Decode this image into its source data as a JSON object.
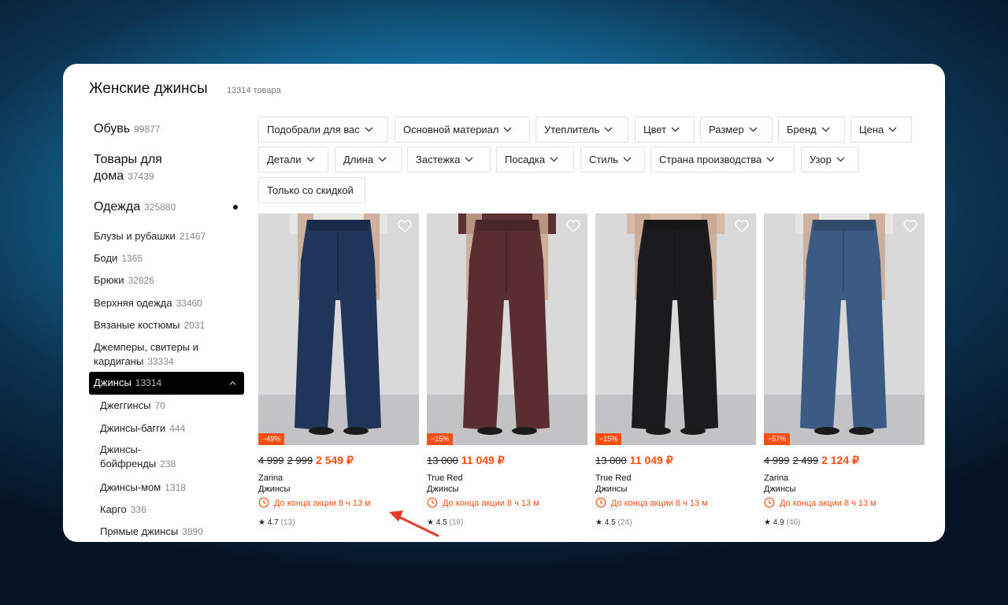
{
  "header": {
    "title": "Женские джинсы",
    "count": "13314 товара"
  },
  "sidebar": {
    "top": [
      {
        "label": "Обувь",
        "count": "99877"
      },
      {
        "label": "Товары для",
        "label2": "дома",
        "count": "37439"
      },
      {
        "label": "Одежда",
        "count": "325880"
      }
    ],
    "subs": [
      {
        "label": "Блузы и рубашки",
        "count": "21467"
      },
      {
        "label": "Боди",
        "count": "1365"
      },
      {
        "label": "Брюки",
        "count": "32826"
      },
      {
        "label": "Верхняя одежда",
        "count": "33460"
      },
      {
        "label": "Вязаные костюмы",
        "count": "2031"
      },
      {
        "label": "Джемперы, свитеры и",
        "label2": "кардиганы",
        "count": "33334"
      }
    ],
    "active": {
      "label": "Джинсы",
      "count": "13314"
    },
    "subsubs": [
      {
        "label": "Джеггинсы",
        "count": "70"
      },
      {
        "label": "Джинсы-багги",
        "count": "444"
      },
      {
        "label": "Джинсы-",
        "label2": "бойфренды",
        "count": "238"
      },
      {
        "label": "Джинсы-мом",
        "count": "1318"
      },
      {
        "label": "Карго",
        "count": "336"
      },
      {
        "label": "Прямые джинсы",
        "count": "3890"
      }
    ]
  },
  "filters": [
    "Подобрали для вас",
    "Основной материал",
    "Утеплитель",
    "Цвет",
    "Размер",
    "Бренд",
    "Цена",
    "Детали",
    "Длина",
    "Застежка",
    "Посадка",
    "Стиль",
    "Страна производства",
    "Узор",
    "Только со скидкой"
  ],
  "products": [
    {
      "discount": "−49%",
      "old1": "4 999",
      "old2": "2 999",
      "price": "2 549 ₽",
      "brand": "Zarina",
      "type": "Джинсы",
      "timer": "До конца акции 8 ч 13 м",
      "rating": "★ 4.7",
      "reviews": "(13)",
      "pants_color": "#1f3559",
      "top_color": "#e8e6e3"
    },
    {
      "discount": "−15%",
      "old1": "13 000",
      "old2": "",
      "price": "11 049 ₽",
      "brand": "True Red",
      "type": "Джинсы",
      "timer": "До конца акции 8 ч 13 м",
      "rating": "★ 4.5",
      "reviews": "(18)",
      "pants_color": "#5a2e30",
      "top_color": "#5b3133"
    },
    {
      "discount": "−15%",
      "old1": "13 000",
      "old2": "",
      "price": "11 049 ₽",
      "brand": "True Red",
      "type": "Джинсы",
      "timer": "До конца акции 8 ч 13 м",
      "rating": "★ 4.5",
      "reviews": "(24)",
      "pants_color": "#1b1b1d",
      "top_color": "#d6b9a6"
    },
    {
      "discount": "−57%",
      "old1": "4 999",
      "old2": "2 499",
      "price": "2 124 ₽",
      "brand": "Zarina",
      "type": "Джинсы",
      "timer": "До конца акции 8 ч 13 м",
      "rating": "★ 4.9",
      "reviews": "(40)",
      "pants_color": "#3b5b84",
      "top_color": "#e8e6e3"
    }
  ]
}
